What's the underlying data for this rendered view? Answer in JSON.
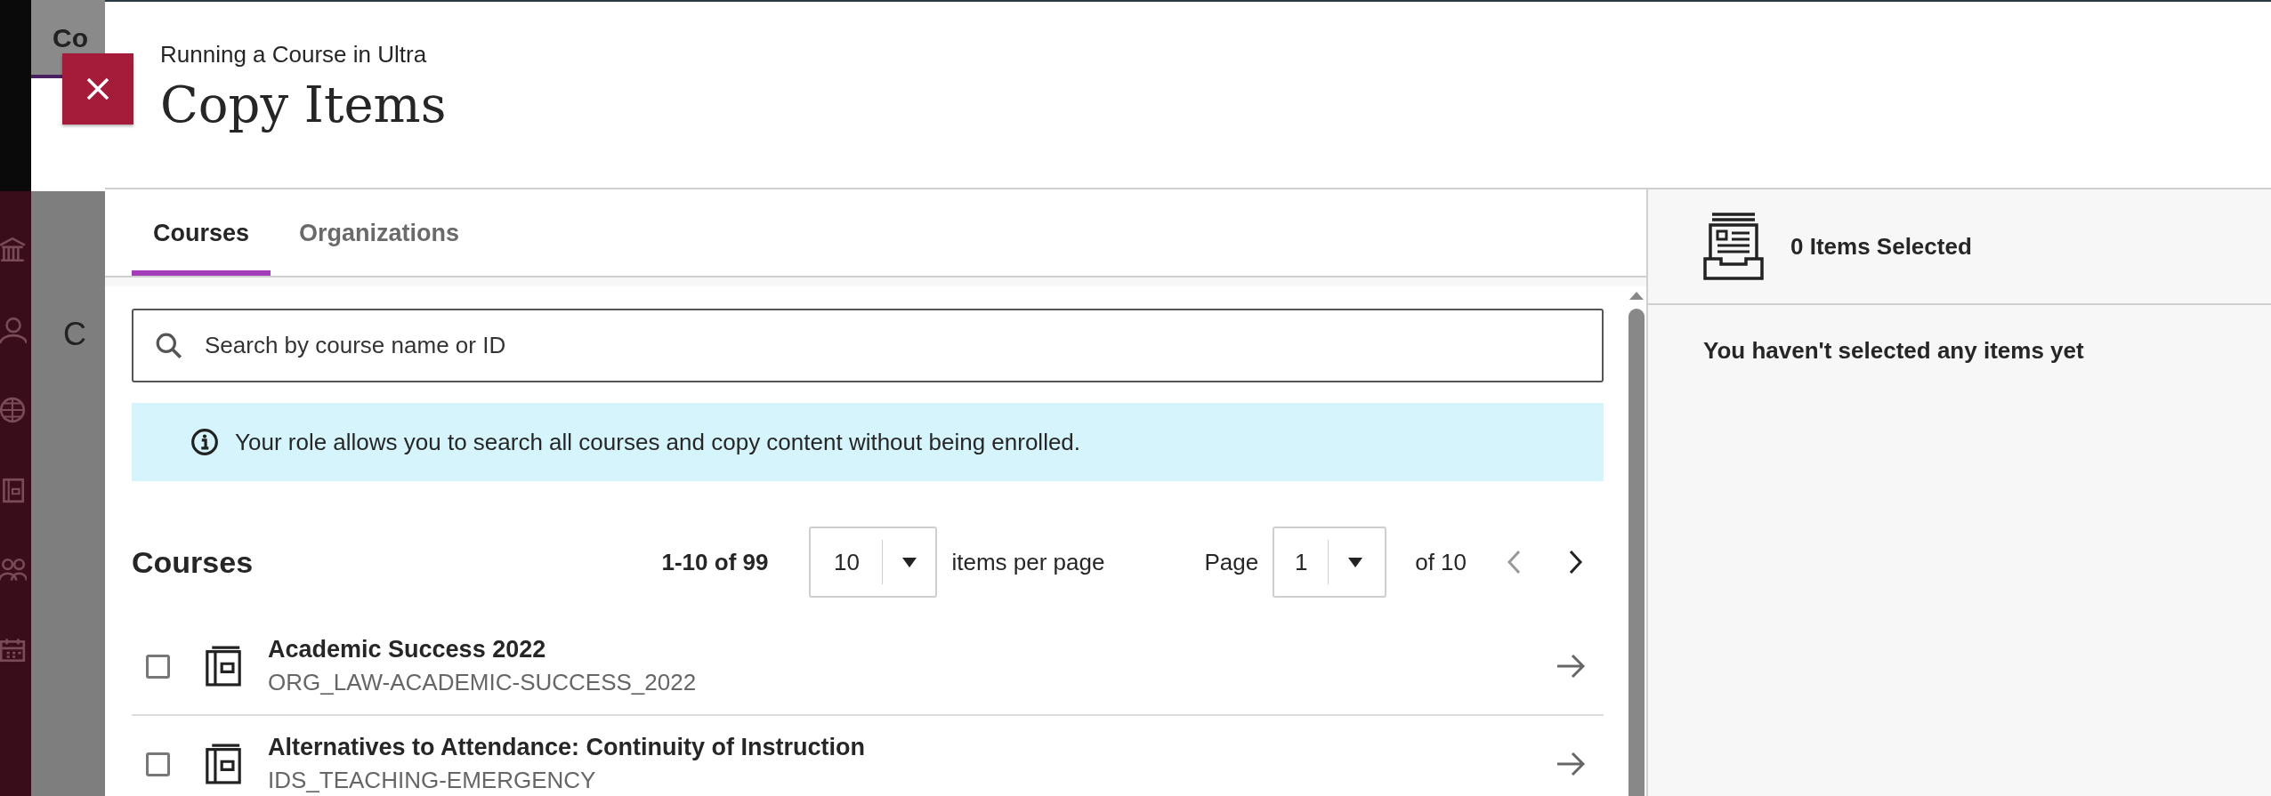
{
  "background": {
    "tab_label": "Co",
    "heading": "C"
  },
  "header": {
    "breadcrumb": "Running a Course in Ultra",
    "title": "Copy Items"
  },
  "tabs": [
    {
      "label": "Courses",
      "selected": true
    },
    {
      "label": "Organizations",
      "selected": false
    }
  ],
  "search": {
    "placeholder": "Search by course name or ID"
  },
  "notice": "Your role allows you to search all courses and copy content without being enrolled.",
  "courses": {
    "heading": "Courses",
    "range": "1-10 of 99",
    "page_size": "10",
    "page_size_label": "items per page",
    "page_label": "Page",
    "page": "1",
    "page_total": "of 10",
    "prev": {
      "disabled": true
    },
    "next": {
      "disabled": false
    },
    "rows": [
      {
        "name": "Academic Success 2022",
        "code": "ORG_LAW-ACADEMIC-SUCCESS_2022",
        "checked": false
      },
      {
        "name": "Alternatives to Attendance: Continuity of Instruction",
        "code": "IDS_TEACHING-EMERGENCY",
        "checked": false
      }
    ]
  },
  "selection": {
    "count": "0 Items Selected",
    "empty_message": "You haven't selected any items yet"
  }
}
